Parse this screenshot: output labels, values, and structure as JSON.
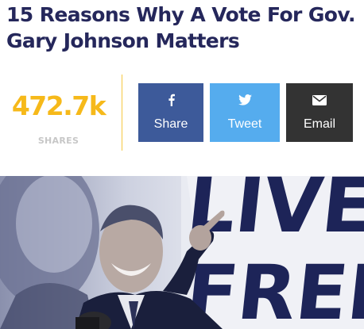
{
  "article": {
    "title": "15 Reasons Why A Vote For Gov. Gary Johnson Matters"
  },
  "share_count": {
    "value": "472.7k",
    "label": "SHARES"
  },
  "share_buttons": [
    {
      "label": "Share",
      "icon": "facebook-icon",
      "color": "#3d5a9a"
    },
    {
      "label": "Tweet",
      "icon": "twitter-bird-icon",
      "color": "#55acee"
    },
    {
      "label": "Email",
      "icon": "envelope-icon",
      "color": "#333333"
    }
  ],
  "hero_image": {
    "sign_text": "LIVE FREE"
  },
  "colors": {
    "headline": "#25275b",
    "count": "#f6b91a",
    "divider": "#f6c842"
  }
}
